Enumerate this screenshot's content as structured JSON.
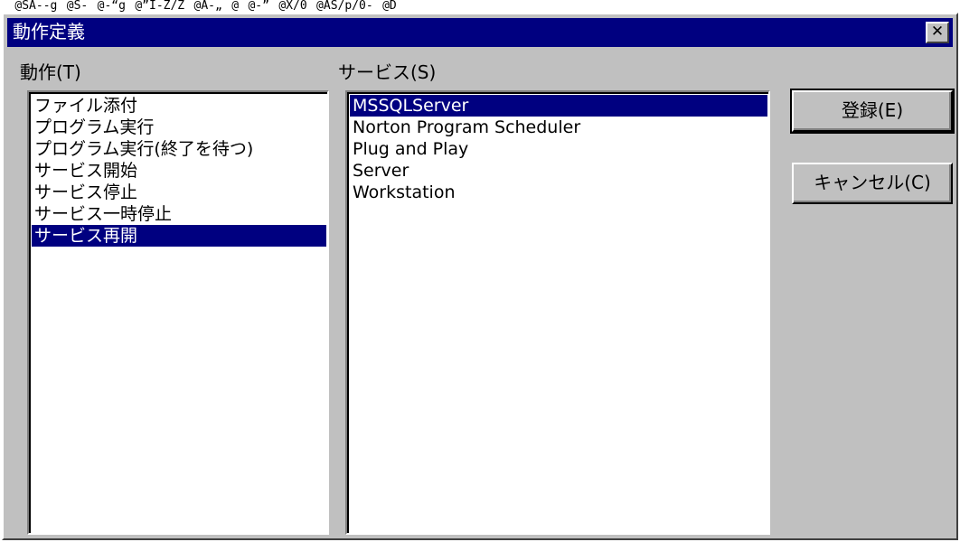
{
  "top_strip_text": "@SA‐‐g@S‐@‐“g@”I‐Z/Z@A‐„@@‐”@X/0@AS/p/0‐@D",
  "window": {
    "title": "動作定義",
    "close_glyph": "✕"
  },
  "actions": {
    "label": "動作(T)",
    "items": [
      "ファイル添付",
      "プログラム実行",
      "プログラム実行(終了を待つ)",
      "サービス開始",
      "サービス停止",
      "サービス一時停止",
      "サービス再開"
    ],
    "selected_index": 6
  },
  "services": {
    "label": "サービス(S)",
    "items": [
      "MSSQLServer",
      "Norton Program Scheduler",
      "Plug and Play",
      "Server",
      "Workstation"
    ],
    "selected_index": 0
  },
  "buttons": {
    "register": "登録(E)",
    "cancel": "キャンセル(C)"
  },
  "colors": {
    "title_bar": "#000080",
    "selection": "#000080",
    "face": "#c0c0c0"
  }
}
